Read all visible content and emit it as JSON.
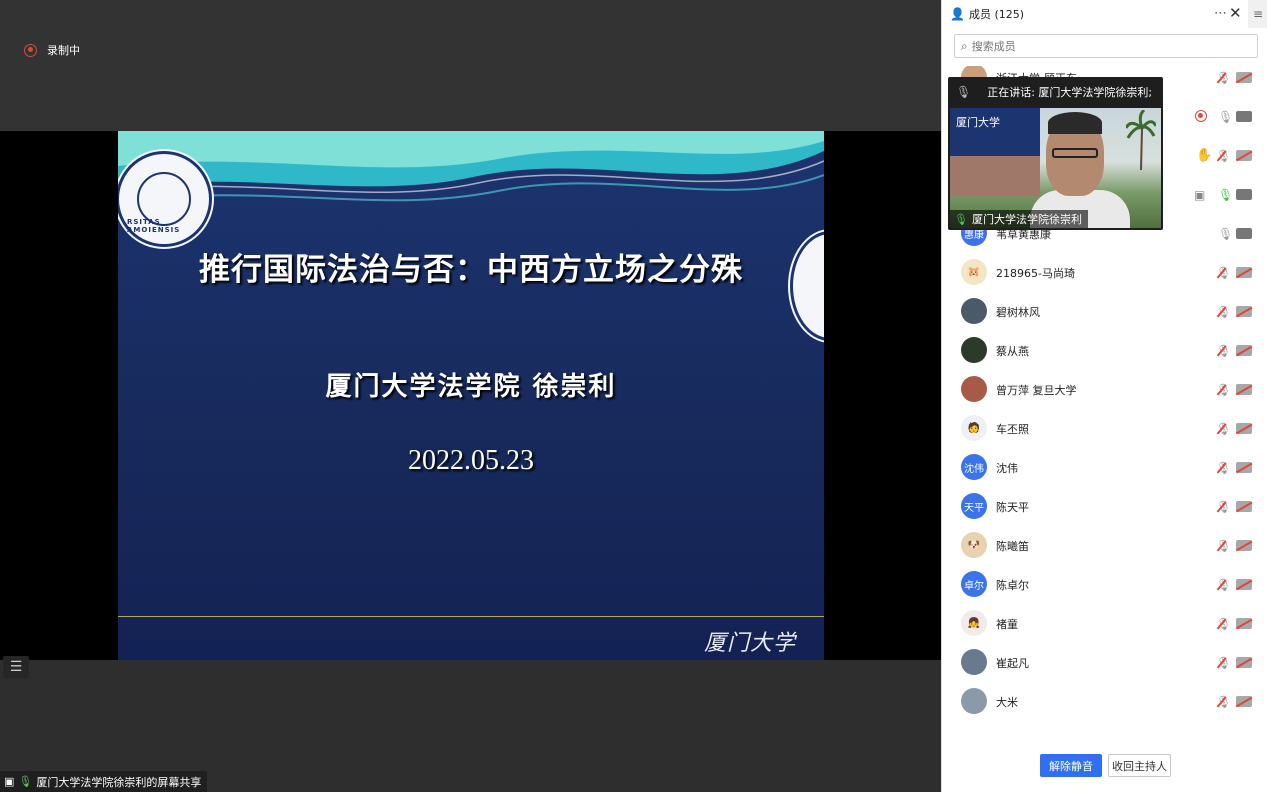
{
  "recording": {
    "label": "录制中"
  },
  "slide": {
    "title": "推行国际法治与否：中西方立场之分殊",
    "author": "厦门大学法学院 徐崇利",
    "date": "2022.05.23",
    "seal_text": "RSITAS AMOIENSIS",
    "footer_logo": "厦门大学"
  },
  "share_tag": {
    "label": "厦门大学法学院徐崇利的屏幕共享"
  },
  "panel": {
    "title": "成员 (125)",
    "search_placeholder": "搜索成员",
    "unmute_all": "解除静音",
    "reclaim_host": "收回主持人"
  },
  "speaker": {
    "talking_label": "正在讲话: 厦门大学法学院徐崇利;",
    "name": "厦门大学法学院徐崇利",
    "video_tile_text": "厦门大学"
  },
  "members": [
    {
      "name": "浙江大学-顾正东",
      "avatar": "",
      "avatar_color": "#c9a07a",
      "status": "muted"
    },
    {
      "name": "",
      "avatar": "",
      "avatar_color": "#888",
      "status": "recording"
    },
    {
      "name": "",
      "avatar": "",
      "avatar_color": "#888",
      "status": "hand"
    },
    {
      "name": "",
      "avatar": "",
      "avatar_color": "#888",
      "status": "sharing"
    },
    {
      "name": "苇草黄惠康",
      "avatar": "惠康",
      "avatar_color": "#3a73ea",
      "status": "mic_cam"
    },
    {
      "name": "218965-马尚琦",
      "avatar": "🐹",
      "avatar_color": "#f4e6c4",
      "status": "muted"
    },
    {
      "name": "碧树林风",
      "avatar": "",
      "avatar_color": "#4a5a6a",
      "status": "muted"
    },
    {
      "name": "蔡从燕",
      "avatar": "",
      "avatar_color": "#2c3a2a",
      "status": "muted"
    },
    {
      "name": "曾万萍 复旦大学",
      "avatar": "",
      "avatar_color": "#a85a48",
      "status": "muted"
    },
    {
      "name": "车丕照",
      "avatar": "🧑",
      "avatar_color": "#eef0f4",
      "status": "muted"
    },
    {
      "name": "沈伟",
      "avatar": "沈伟",
      "avatar_color": "#3a73ea",
      "status": "muted"
    },
    {
      "name": "陈天平",
      "avatar": "天平",
      "avatar_color": "#3a73ea",
      "status": "muted"
    },
    {
      "name": "陈曦笛",
      "avatar": "🐶",
      "avatar_color": "#e8d2b0",
      "status": "muted"
    },
    {
      "name": "陈卓尔",
      "avatar": "卓尔",
      "avatar_color": "#3a73ea",
      "status": "muted"
    },
    {
      "name": "褚童",
      "avatar": "👧",
      "avatar_color": "#f4eaea",
      "status": "muted"
    },
    {
      "name": "崔起凡",
      "avatar": "",
      "avatar_color": "#6a7a8e",
      "status": "muted"
    },
    {
      "name": "大米",
      "avatar": "",
      "avatar_color": "#8a9aa8",
      "status": "muted"
    }
  ]
}
